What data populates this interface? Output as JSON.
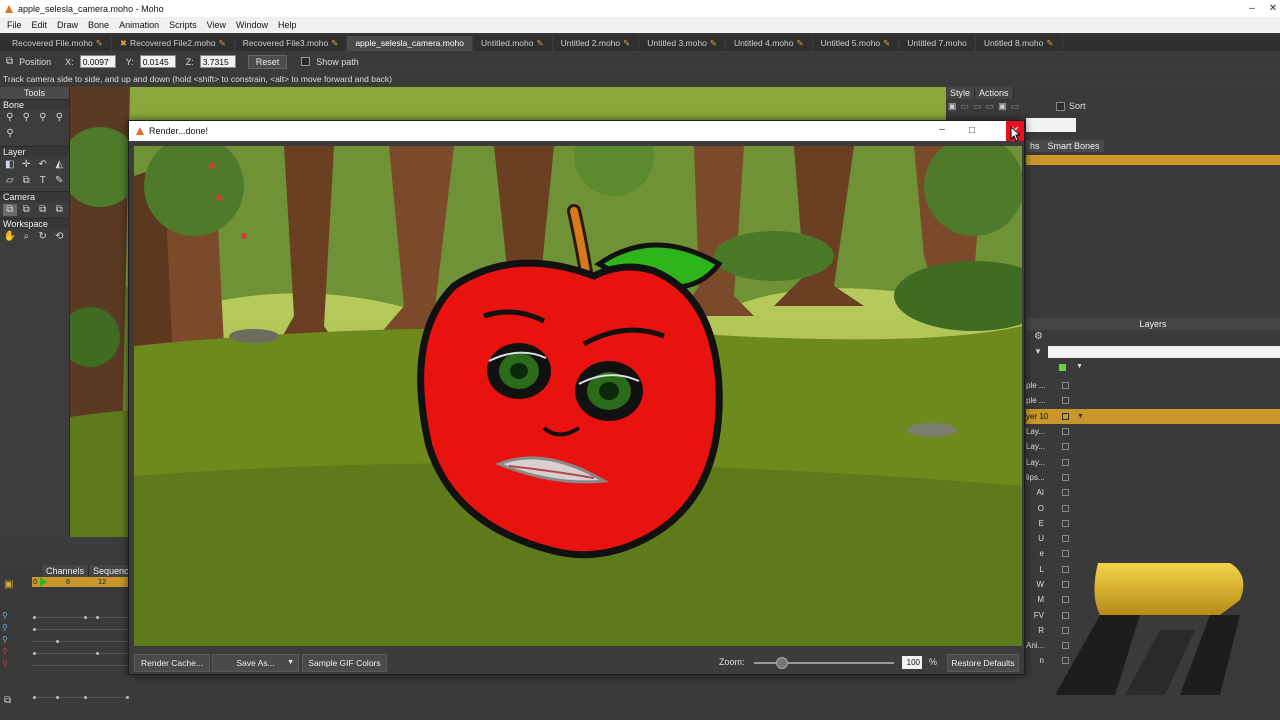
{
  "window": {
    "title": "apple_selesla_camera.moho - Moho",
    "controls": [
      "–",
      "✕"
    ]
  },
  "menu": [
    "File",
    "Edit",
    "Draw",
    "Bone",
    "Animation",
    "Scripts",
    "View",
    "Window",
    "Help"
  ],
  "doc_tabs": [
    {
      "label": "Recovered File.moho",
      "modified": true,
      "closable": false
    },
    {
      "label": "Recovered File2.moho",
      "modified": true,
      "closable": true
    },
    {
      "label": "Recovered File3.moho",
      "modified": true,
      "closable": false
    },
    {
      "label": "apple_selesla_camera.moho",
      "modified": false,
      "active": true
    },
    {
      "label": "Untitled.moho",
      "modified": true
    },
    {
      "label": "Untitled 2.moho",
      "modified": true
    },
    {
      "label": "Untitled 3.moho",
      "modified": true
    },
    {
      "label": "Untitled 4.moho",
      "modified": true
    },
    {
      "label": "Untitled 5.moho",
      "modified": true
    },
    {
      "label": "Untitled 7.moho",
      "modified": false
    },
    {
      "label": "Untitled 8.moho",
      "modified": true
    }
  ],
  "tool_options": {
    "position_label": "Position",
    "x_label": "X:",
    "x_value": "0.0097",
    "y_label": "Y:",
    "y_value": "0.0145",
    "z_label": "Z:",
    "z_value": "3.7315",
    "reset_label": "Reset",
    "show_path_label": "Show path"
  },
  "hint": "Track camera side to side, and up and down (hold <shift> to constrain, <alt> to move forward and back)",
  "tools": {
    "header": "Tools",
    "sections": [
      "Bone",
      "Layer",
      "Camera",
      "Workspace"
    ]
  },
  "right_panel": {
    "tabs": [
      "Style",
      "Actions"
    ],
    "sort_label": "Sort",
    "tabs2": [
      "hs",
      "Smart Bones"
    ],
    "layers_title": "Layers",
    "layers": [
      {
        "name": "ple ...",
        "selected": false
      },
      {
        "name": "ple ...",
        "selected": false
      },
      {
        "name": "yer 10",
        "selected": true
      },
      {
        "name": "Lay...",
        "selected": false
      },
      {
        "name": "Lay...",
        "selected": false
      },
      {
        "name": "Lay...",
        "selected": false
      },
      {
        "name": "lips...",
        "selected": false
      },
      {
        "name": "AI",
        "selected": false
      },
      {
        "name": "O",
        "selected": false
      },
      {
        "name": "E",
        "selected": false
      },
      {
        "name": "U",
        "selected": false
      },
      {
        "name": "e",
        "selected": false
      },
      {
        "name": "L",
        "selected": false
      },
      {
        "name": "W",
        "selected": false
      },
      {
        "name": "M",
        "selected": false
      },
      {
        "name": "FV",
        "selected": false
      },
      {
        "name": "R",
        "selected": false
      },
      {
        "name": "Ani...",
        "selected": false
      },
      {
        "name": "n",
        "selected": false
      }
    ]
  },
  "timeline": {
    "tabs": [
      "Channels",
      "Sequencer"
    ],
    "ruler": [
      "0",
      "6",
      "12"
    ]
  },
  "render_window": {
    "title": "Render...done!",
    "buttons": {
      "render_cache": "Render Cache...",
      "save_as": "Save As...",
      "sample_gif": "Sample GIF Colors",
      "restore_defaults": "Restore Defaults"
    },
    "zoom_label": "Zoom:",
    "zoom_value": "100",
    "zoom_unit": "%",
    "zoom_fraction": 0.2
  },
  "colors": {
    "accent": "#c9962b",
    "close_red": "#e81123",
    "apple_red": "#e8120f",
    "leaf_green": "#2fb51c",
    "grass": "#6f8a1c"
  }
}
